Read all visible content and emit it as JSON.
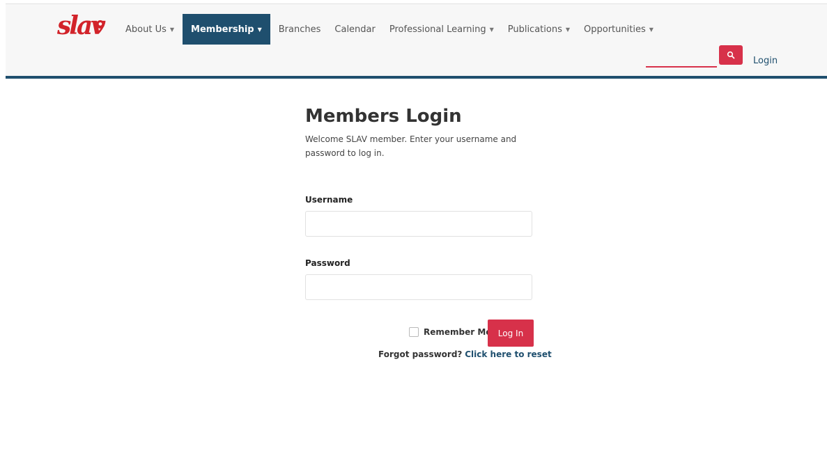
{
  "brand": {
    "logo_text": "slav",
    "logo_badge": "",
    "logo_alt": "SLAV"
  },
  "nav": {
    "items": [
      {
        "label": "About Us",
        "caret": true
      },
      {
        "label": "Membership",
        "caret": true,
        "active": true
      },
      {
        "label": "Branches",
        "caret": false
      },
      {
        "label": "Calendar",
        "caret": false
      },
      {
        "label": "Professional Learning",
        "caret": true
      },
      {
        "label": "Publications",
        "caret": true
      },
      {
        "label": "Opportunities",
        "caret": true
      }
    ]
  },
  "search": {
    "value": "",
    "placeholder": "",
    "icon": "search-icon"
  },
  "header_login": "Login",
  "page": {
    "title": "Members Login",
    "intro": "Welcome SLAV member. Enter your username and password to log in."
  },
  "form": {
    "username_label": "Username",
    "username_value": "",
    "password_label": "Password",
    "password_value": "",
    "remember_label": "Remember Me",
    "remember_checked": false,
    "submit_label": "Log In",
    "forgot_text": "Forgot password?",
    "reset_link": "Click here to reset"
  },
  "colors": {
    "accent": "#d7314a",
    "primary": "#1f4f6e",
    "brand_red": "#d2232a"
  }
}
